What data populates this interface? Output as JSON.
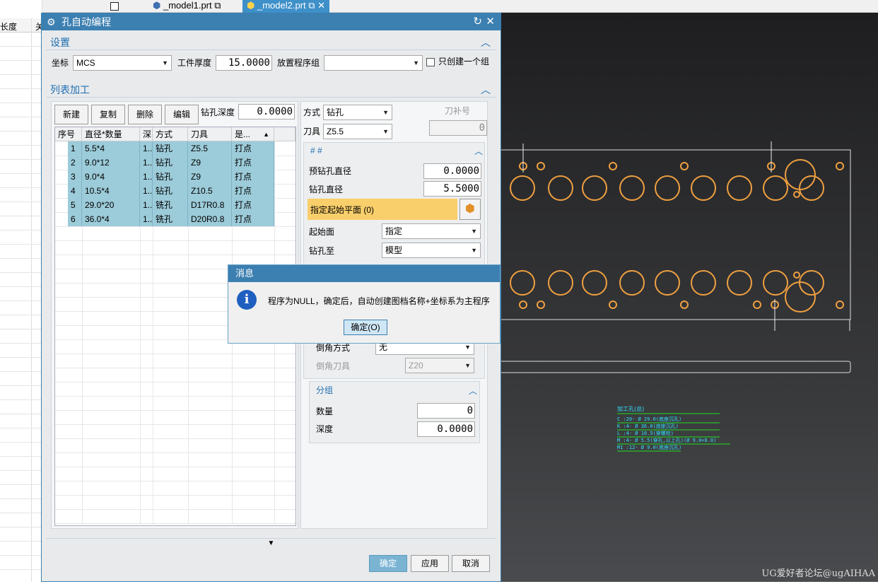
{
  "left_grid": {
    "col1": "长度",
    "col2": "关"
  },
  "tabs": [
    {
      "label": "_model1.prt"
    },
    {
      "label": "_model2.prt"
    }
  ],
  "dialog": {
    "title": "孔自动编程",
    "settings": {
      "header": "设置",
      "coord_label": "坐标",
      "coord_value": "MCS",
      "thickness_label": "工件厚度",
      "thickness_value": "15.0000",
      "group_label": "放置程序组",
      "group_value": "",
      "only_one_group": "只创建一个组"
    },
    "list": {
      "header": "列表加工",
      "buttons": {
        "new": "新建",
        "copy": "复制",
        "delete": "删除",
        "edit": "编辑"
      },
      "depth_label": "钻孔深度",
      "depth_value": "0.0000",
      "columns": [
        "序号",
        "直径*数量",
        "深",
        "方式",
        "刀具",
        "是..."
      ],
      "rows": [
        {
          "no": "1",
          "dia": "5.5*4",
          "d": "1..",
          "mode": "钻孔",
          "tool": "Z5.5",
          "pt": "打点"
        },
        {
          "no": "2",
          "dia": "9.0*12",
          "d": "1..",
          "mode": "钻孔",
          "tool": "Z9",
          "pt": "打点"
        },
        {
          "no": "3",
          "dia": "9.0*4",
          "d": "1..",
          "mode": "钻孔",
          "tool": "Z9",
          "pt": "打点"
        },
        {
          "no": "4",
          "dia": "10.5*4",
          "d": "1..",
          "mode": "钻孔",
          "tool": "Z10.5",
          "pt": "打点"
        },
        {
          "no": "5",
          "dia": "29.0*20",
          "d": "1..",
          "mode": "铣孔",
          "tool": "D17R0.8",
          "pt": "打点"
        },
        {
          "no": "6",
          "dia": "36.0*4",
          "d": "1..",
          "mode": "铣孔",
          "tool": "D20R0.8",
          "pt": "打点"
        }
      ]
    },
    "right": {
      "mode_label": "方式",
      "mode_value": "钻孔",
      "tool_label": "刀具",
      "tool_value": "Z5.5",
      "comp_label": "刀补号",
      "comp_value": "0",
      "sub_header": "# #",
      "predrill_label": "预钻孔直径",
      "predrill_value": "0.0000",
      "drill_label": "钻孔直径",
      "drill_value": "5.5000",
      "start_plane": "指定起始平面 (0)",
      "start_face_label": "起始面",
      "start_face_value": "指定",
      "drill_to_label": "钻孔至",
      "drill_to_value": "模型",
      "chamfer_label": "倒角方式",
      "chamfer_value": "无",
      "chamfer_tool_label": "倒角刀具",
      "chamfer_tool_value": "Z20",
      "group_header": "分组",
      "count_label": "数量",
      "count_value": "0",
      "gdepth_label": "深度",
      "gdepth_value": "0.0000"
    },
    "footer": {
      "ok": "确定",
      "apply": "应用",
      "cancel": "取消"
    }
  },
  "message": {
    "title": "消息",
    "text": "程序为NULL，确定后，自动创建图档名称+坐标系为主程序",
    "ok": "确定(O)"
  },
  "drawing": {
    "table_title": "加工孔(总)",
    "rows": [
      "C  :20- Ø 29.0(底座沉孔)",
      "K  :4- Ø 36.0(底座沉孔)",
      "L  :4- Ø 10.5(穿螺栓)",
      "M  :4- Ø 5.5(穿孔,以上孔)(Ø 9.0×8.0)",
      "M1 :12- Ø 9.0(底座沉孔)"
    ]
  },
  "watermark": "UG爱好者论坛@ugAIHAA"
}
